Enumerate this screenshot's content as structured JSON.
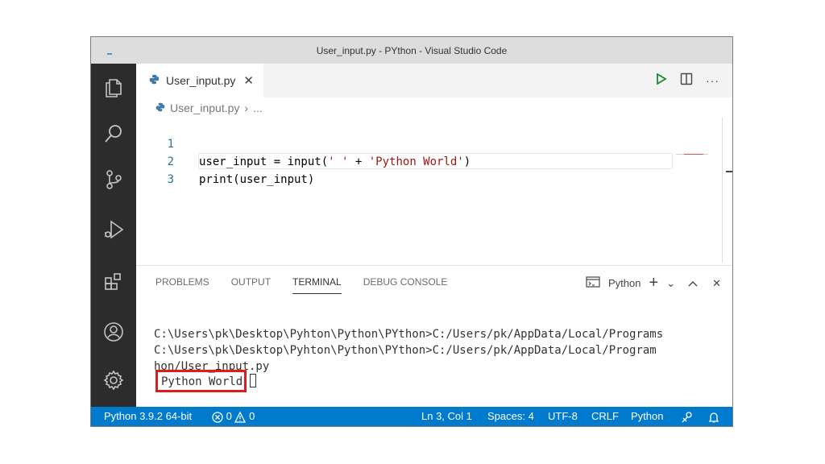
{
  "window": {
    "title": "User_input.py - PYthon - Visual Studio Code"
  },
  "activity_bar": {
    "items": [
      {
        "name": "explorer-icon"
      },
      {
        "name": "search-icon"
      },
      {
        "name": "source-control-icon"
      },
      {
        "name": "run-debug-icon"
      },
      {
        "name": "extensions-icon"
      },
      {
        "name": "accounts-icon"
      },
      {
        "name": "settings-gear-icon"
      }
    ]
  },
  "editor": {
    "tab": {
      "label": "User_input.py",
      "close": "✕"
    },
    "actions": {
      "run": "▷",
      "split": "split-editor-icon",
      "more": "···"
    },
    "breadcrumb": {
      "file": "User_input.py",
      "sep": "›",
      "more": "..."
    },
    "lines": [
      {
        "num": "1",
        "parts": [
          {
            "t": "user_input = input(",
            "s": "code"
          },
          {
            "t": "' '",
            "s": "str"
          },
          {
            "t": " + ",
            "s": "code"
          },
          {
            "t": "'Python World'",
            "s": "str"
          },
          {
            "t": ")",
            "s": "code"
          }
        ]
      },
      {
        "num": "2",
        "parts": [
          {
            "t": "print(user_input)",
            "s": "code"
          }
        ]
      },
      {
        "num": "3",
        "parts": []
      }
    ],
    "line1_a": "user_input = input(",
    "line1_b": "' '",
    "line1_c": " + ",
    "line1_d": "'Python World'",
    "line1_e": ")",
    "line2": "print(user_input)"
  },
  "panel": {
    "tabs": [
      "PROBLEMS",
      "OUTPUT",
      "TERMINAL",
      "DEBUG CONSOLE"
    ],
    "active_tab": "TERMINAL",
    "terminal_selector": "Python",
    "add": "+",
    "chevron": "⌄",
    "maximize": "^",
    "close": "✕",
    "terminal_lines": [
      "C:\\Users\\pk\\Desktop\\Pyhton\\Python\\PYthon>C:/Users/pk/AppData/Local/Programs",
      "C:\\Users\\pk\\Desktop\\Pyhton\\Python\\PYthon>C:/Users/pk/AppData/Local/Program",
      "hon/User_input.py",
      "Python World"
    ]
  },
  "statusbar": {
    "interpreter": "Python 3.9.2 64-bit",
    "errors": "0",
    "warnings": "0",
    "position": "Ln 3, Col 1",
    "spaces": "Spaces: 4",
    "encoding": "UTF-8",
    "eol": "CRLF",
    "language": "Python"
  },
  "colors": {
    "activity_bar": "#2c2c2c",
    "statusbar": "#007acc",
    "highlight": "#e01b1b",
    "string": "#a31515",
    "line_number": "#237893"
  }
}
